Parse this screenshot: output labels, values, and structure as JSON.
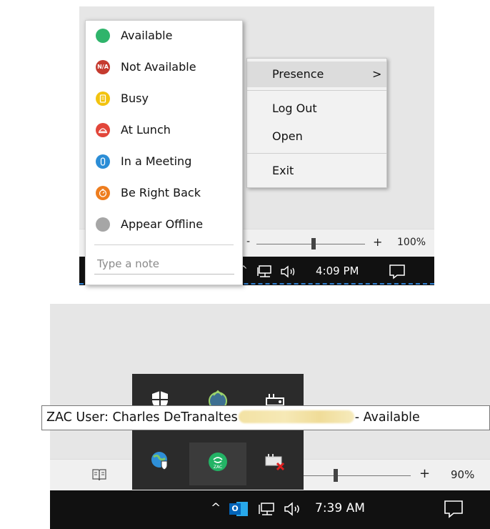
{
  "top": {
    "presence_menu": {
      "items": [
        {
          "label": "Available",
          "icon": "available-dot-icon",
          "color": "#2fb46b",
          "glyph": ""
        },
        {
          "label": "Not Available",
          "icon": "not-available-icon",
          "color": "#c53b2f",
          "glyph": "N/A"
        },
        {
          "label": "Busy",
          "icon": "busy-icon",
          "color": "#f2c30f",
          "glyph": ""
        },
        {
          "label": "At Lunch",
          "icon": "at-lunch-icon",
          "color": "#e2463a",
          "glyph": ""
        },
        {
          "label": "In a Meeting",
          "icon": "in-a-meeting-icon",
          "color": "#2b8dd6",
          "glyph": ""
        },
        {
          "label": "Be Right Back",
          "icon": "be-right-back-icon",
          "color": "#ee7d1e",
          "glyph": ""
        },
        {
          "label": "Appear Offline",
          "icon": "appear-offline-icon",
          "color": "#a6a6a6",
          "glyph": ""
        }
      ],
      "note_placeholder": "Type a note"
    },
    "context_menu": {
      "presence": "Presence",
      "presence_arrow": ">",
      "log_out": "Log Out",
      "open": "Open",
      "exit": "Exit"
    },
    "zoom": {
      "minus": "-",
      "plus": "+",
      "percent": "100%",
      "level": 0.5
    },
    "taskbar": {
      "chevron": "^",
      "time": "4:09 PM"
    }
  },
  "bottom": {
    "tray_icons": [
      "security-shield-icon",
      "zac-sync-icon",
      "network-drive-icon",
      "globe-shield-icon",
      "zac-presence-icon",
      "disconnected-drive-icon"
    ],
    "tooltip": {
      "prefix": "ZAC User: Charles DeTranaltes",
      "suffix": "- Available"
    },
    "zoom": {
      "minus": "-",
      "plus": "+",
      "percent": "90%",
      "level": 0.45
    },
    "taskbar": {
      "chevron": "^",
      "outlook_letter": "O",
      "time": "7:39 AM"
    }
  }
}
